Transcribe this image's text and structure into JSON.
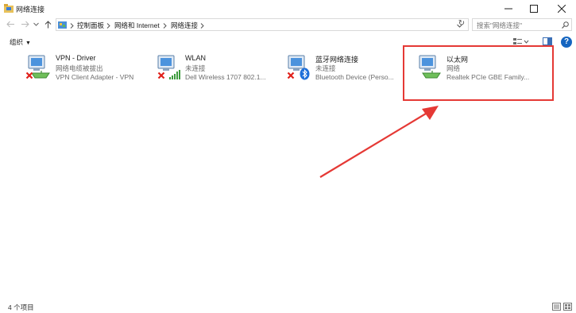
{
  "window": {
    "title": "网络连接",
    "controls": [
      "minimize",
      "maximize",
      "close"
    ]
  },
  "navigation": {
    "back_icon": "arrow-left-icon",
    "forward_icon": "arrow-right-icon",
    "recent_icon": "chevron-down-icon",
    "up_icon": "arrow-up-icon"
  },
  "address": {
    "breadcrumbs": [
      "控制面板",
      "网络和 Internet",
      "网络连接"
    ],
    "refresh_icon": "refresh-icon"
  },
  "search": {
    "placeholder": "搜索\"网络连接\""
  },
  "toolbar": {
    "organize_label": "组织"
  },
  "connections": [
    {
      "name": "VPN - Driver",
      "status": "网络电缆被拔出",
      "device": "VPN Client Adapter - VPN",
      "overlay": "red-x",
      "highlighted": false
    },
    {
      "name": "WLAN",
      "status": "未连接",
      "device": "Dell Wireless 1707 802.1...",
      "overlay": "red-x",
      "badge": "signal-bars-icon",
      "highlighted": false
    },
    {
      "name": "蓝牙网络连接",
      "status": "未连接",
      "device": "Bluetooth Device (Perso...",
      "overlay": "red-x",
      "badge": "bluetooth-icon",
      "highlighted": false
    },
    {
      "name": "以太网",
      "status": "网络",
      "device": "Realtek PCIe GBE Family...",
      "overlay": "none",
      "highlighted": true
    }
  ],
  "annotation": {
    "color": "#e53935"
  },
  "statusbar": {
    "item_count": "4 个项目"
  },
  "colors": {
    "help_blue": "#1565c0",
    "annotation_red": "#e53935",
    "secondary_text": "#6d6d6d"
  }
}
